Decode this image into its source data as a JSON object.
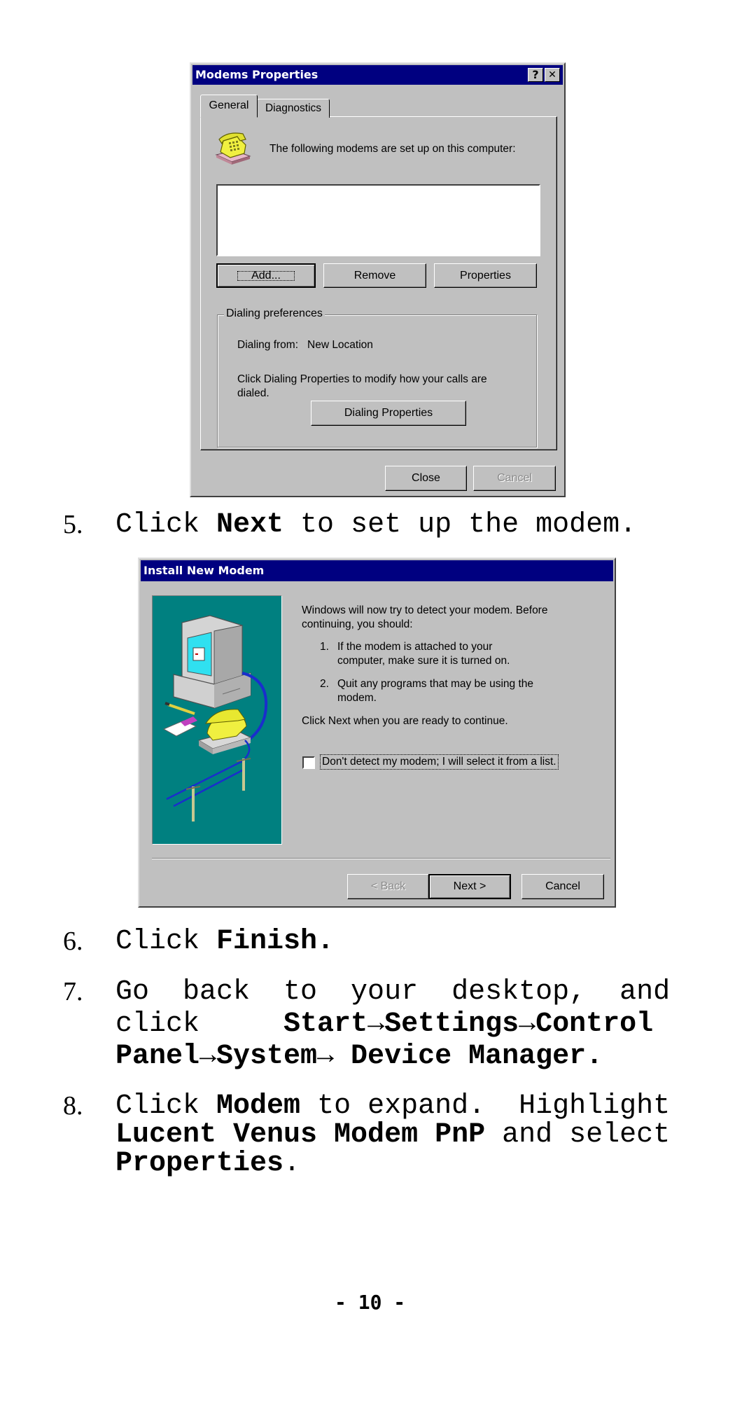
{
  "dialog1": {
    "title": "Modems Properties",
    "help_button": "?",
    "close_button": "✕",
    "tabs": [
      {
        "label": "General",
        "active": true
      },
      {
        "label": "Diagnostics",
        "active": false
      }
    ],
    "icon": "telephone-icon",
    "intro_text": "The following modems are set up on this computer:",
    "modem_list": [],
    "buttons": {
      "add": "Add...",
      "remove": "Remove",
      "properties": "Properties"
    },
    "dialing_group": {
      "label": "Dialing preferences",
      "dialing_from_label": "Dialing from:",
      "dialing_from_value": "New Location",
      "help_text_line1": "Click Dialing Properties to modify how your calls are",
      "help_text_line2": "dialed.",
      "dialing_properties_button": "Dialing Properties"
    },
    "footer": {
      "close": "Close",
      "cancel": "Cancel"
    }
  },
  "step5": {
    "number": "5.",
    "pre": "Click ",
    "bold": "Next",
    "post": " to set up the modem."
  },
  "dialog2": {
    "title": "Install New Modem",
    "illustration": "computer-modem-illustration",
    "intro_line1": "Windows will now try to detect your modem.  Before",
    "intro_line2": "continuing, you should:",
    "list": [
      {
        "num": "1.",
        "line1": "If the modem is attached to your",
        "line2": "computer, make sure it is turned on."
      },
      {
        "num": "2.",
        "line1": "Quit any programs that may be using the",
        "line2": "modem."
      }
    ],
    "continue_text": "Click Next when you are ready to continue.",
    "checkbox": {
      "label": "Don't detect my modem; I will select it from a list.",
      "checked": false
    },
    "buttons": {
      "back": "< Back",
      "next": "Next >",
      "cancel": "Cancel"
    }
  },
  "step6": {
    "number": "6.",
    "pre": "Click ",
    "bold": "Finish."
  },
  "step7": {
    "number": "7.",
    "line1": "Go  back  to  your  desktop,  and",
    "line2_pre": "click     ",
    "line2_bold": "Start→Settings→Control",
    "line3_bold": "Panel→System→ Device Manager."
  },
  "step8": {
    "number": "8.",
    "line1_pre": "Click ",
    "line1_bold": "Modem",
    "line1_post": " to expand.  Highlight",
    "line2_bold": "Lucent Venus Modem PnP",
    "line2_post": " and select",
    "line3_bold": "Properties",
    "line3_post": "."
  },
  "page_number": "- 10 -"
}
